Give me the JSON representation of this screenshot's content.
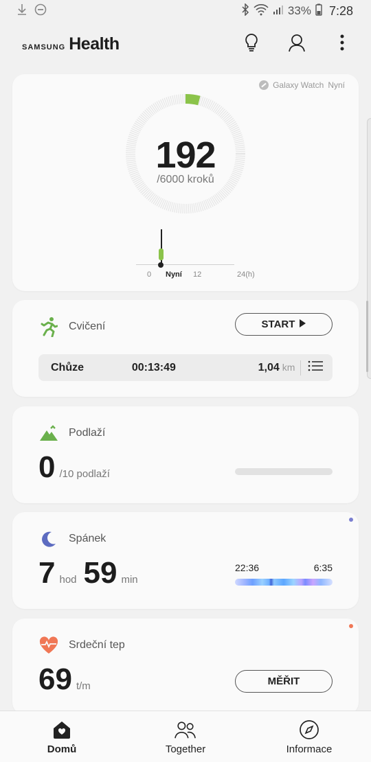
{
  "status_bar": {
    "battery": "33%",
    "time": "7:28",
    "left_icons": [
      "download-icon",
      "dnd-icon"
    ],
    "right_icons": [
      "bluetooth-icon",
      "wifi-icon",
      "signal-icon",
      "battery-icon"
    ]
  },
  "header": {
    "brand_samsung": "SAMSUNG",
    "brand_health": "Health",
    "actions": [
      "bulb-icon",
      "person-icon",
      "more-icon"
    ]
  },
  "steps": {
    "source_device": "Galaxy Watch",
    "source_time": "Nyní",
    "value": "192",
    "goal": "/6000 kroků",
    "progress": 0.032,
    "timeline_ticks": {
      "t0": "0",
      "now": "Nyní",
      "t12": "12",
      "t24": "24(h)"
    },
    "accent": "#8bc34a"
  },
  "exercise": {
    "title": "Cvičení",
    "start_label": "START",
    "activity": {
      "name": "Chůze",
      "duration": "00:13:49",
      "distance": "1,04",
      "distance_unit": "km"
    },
    "accent": "#6ab04c"
  },
  "floors": {
    "title": "Podlaží",
    "value": "0",
    "unit": "/10 podlaží",
    "progress": 0,
    "accent": "#6ab04c"
  },
  "sleep": {
    "title": "Spánek",
    "hours": "7",
    "hours_unit": "hod",
    "minutes": "59",
    "minutes_unit": "min",
    "start_time": "22:36",
    "end_time": "6:35",
    "accent": "#5c6bc0",
    "badge_color": "#7b7fd0"
  },
  "heart_rate": {
    "title": "Srdeční tep",
    "value": "69",
    "unit": "t/m",
    "measure_label": "MĚŘIT",
    "accent": "#f07755",
    "badge_color": "#f07755"
  },
  "bottom_nav": {
    "items": [
      {
        "label": "Domů",
        "icon": "home-icon",
        "active": true
      },
      {
        "label": "Together",
        "icon": "people-icon",
        "active": false
      },
      {
        "label": "Informace",
        "icon": "compass-icon",
        "active": false
      }
    ]
  }
}
